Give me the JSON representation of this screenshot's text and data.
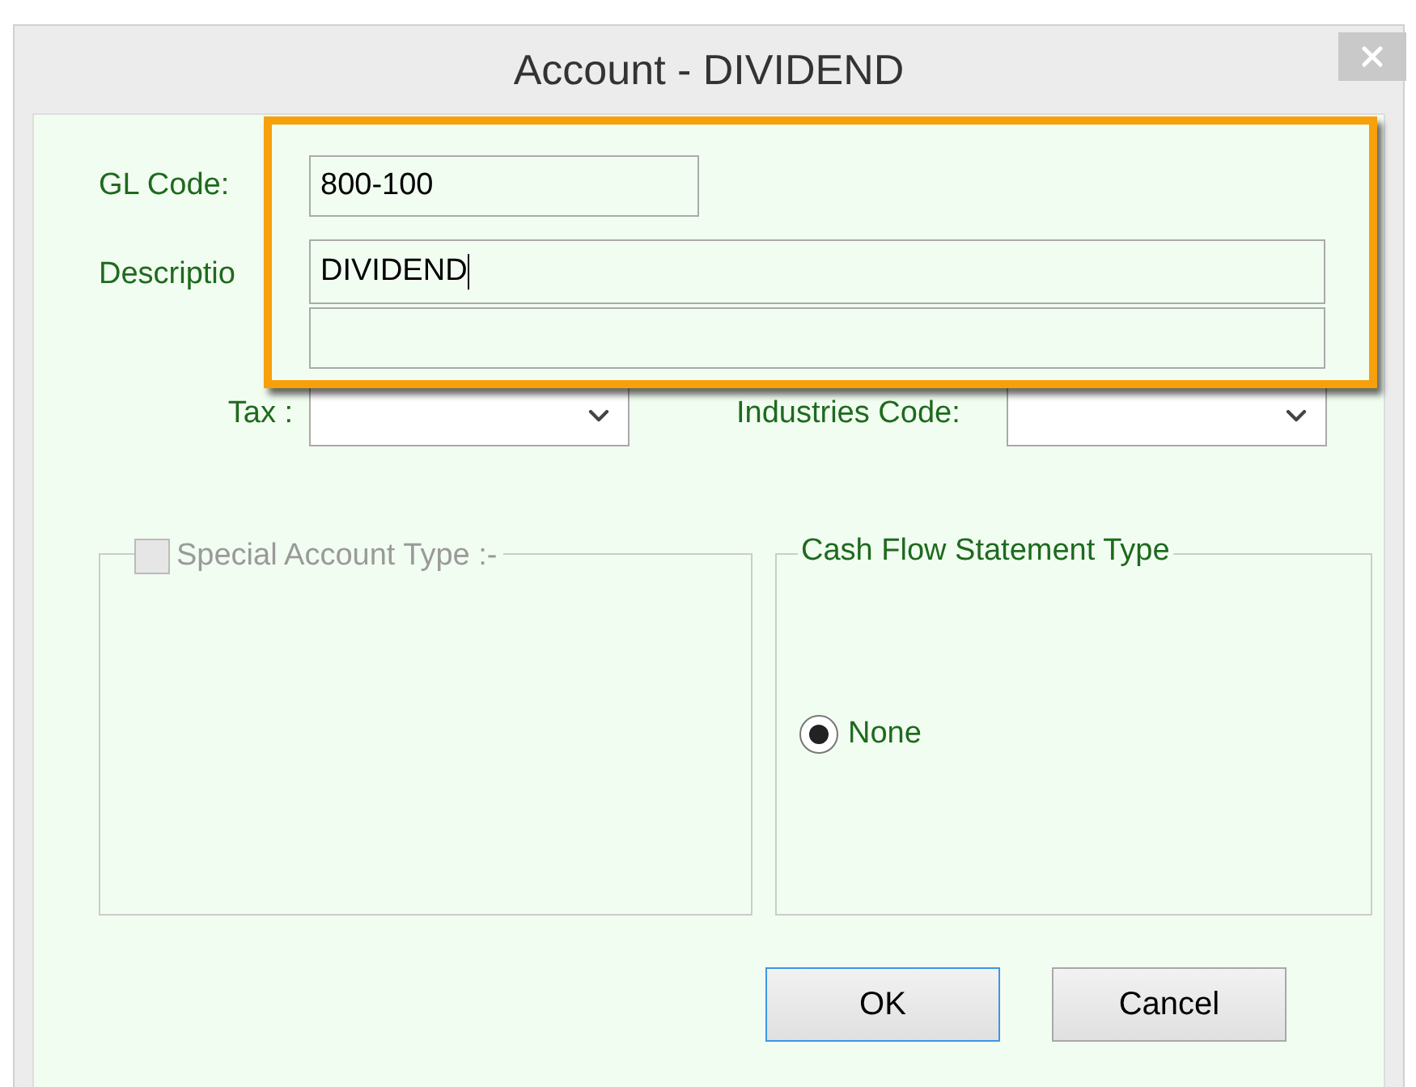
{
  "window": {
    "title": "Account - DIVIDEND"
  },
  "form": {
    "gl_code": {
      "label": "GL Code:",
      "value": "800-100"
    },
    "description": {
      "label": "Descriptio",
      "value": "DIVIDEND"
    },
    "tax": {
      "label": "Tax :"
    },
    "industries_code": {
      "label": "Industries Code:"
    }
  },
  "special_account_type": {
    "label": "Special Account Type :-",
    "checked": false,
    "disabled": true
  },
  "cash_flow_statement_type": {
    "title": "Cash Flow Statement Type",
    "options": [
      {
        "label": "None",
        "selected": true
      }
    ]
  },
  "buttons": [
    {
      "label": "OK",
      "default": true
    },
    {
      "label": "Cancel",
      "default": false
    }
  ]
}
